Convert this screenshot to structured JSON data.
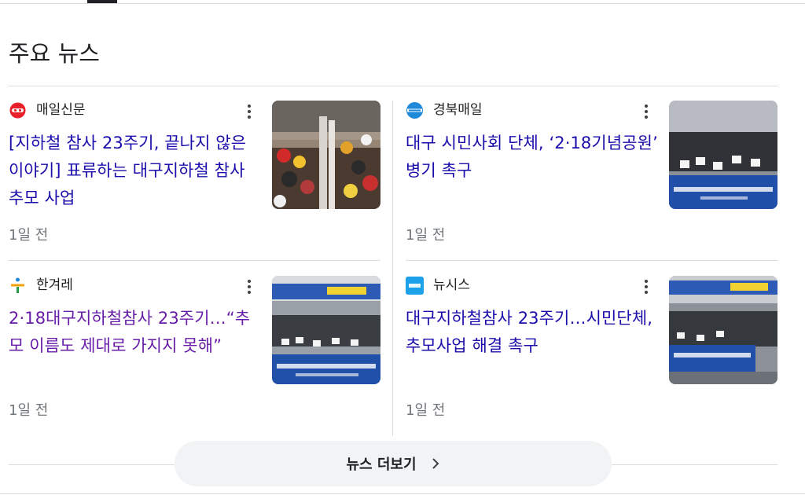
{
  "section": {
    "title": "주요 뉴스"
  },
  "cards": [
    {
      "source": "매일신문",
      "logo": "maeil-shinmun-logo",
      "headline": "[지하철 참사 23주기, 끝나지 않은 이야기] 표류하는 대구지하철 참사 추모 사업",
      "age": "1일 전",
      "visited": false
    },
    {
      "source": "경북매일",
      "logo": "kyongbuk-maeil-logo",
      "headline": "대구 시민사회 단체, ‘2·18기념공원’ 병기 촉구",
      "age": "1일 전",
      "visited": false
    },
    {
      "source": "한겨레",
      "logo": "hankyoreh-logo",
      "headline": "2·18대구지하철참사 23주기…“추모 이름도 제대로 가지지 못해”",
      "age": "1일 전",
      "visited": true
    },
    {
      "source": "뉴시스",
      "logo": "newsis-logo",
      "headline": "대구지하철참사 23주기…시민단체, 추모사업 해결 촉구",
      "age": "1일 전",
      "visited": false
    }
  ],
  "more_button": {
    "label": "뉴스 더보기",
    "icon": "chevron-right-icon"
  },
  "colors": {
    "link": "#1a0dab",
    "visited_link": "#681da8",
    "meta_text": "#70757a",
    "divider": "#dadce0",
    "button_bg": "#f1f3f4"
  }
}
